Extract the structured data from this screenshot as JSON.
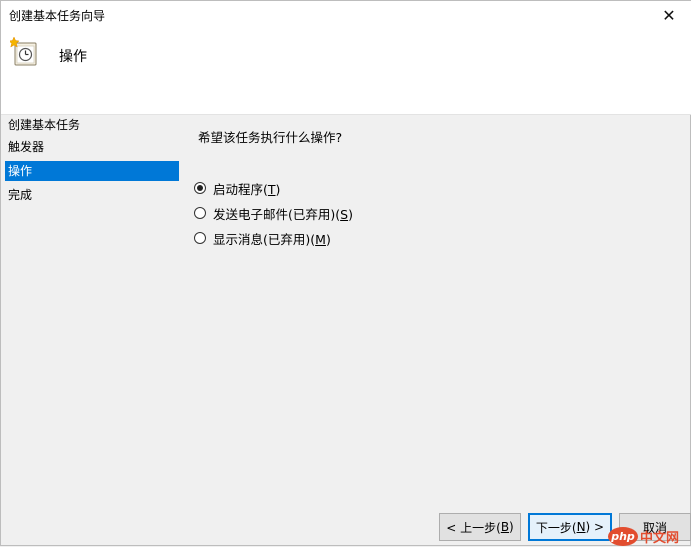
{
  "window": {
    "title": "创建基本任务向导",
    "close_glyph": "✕"
  },
  "header": {
    "title": "操作",
    "icon": "scheduled-task-icon"
  },
  "sidebar": {
    "items": [
      {
        "label": "创建基本任务",
        "active": false
      },
      {
        "label": "触发器",
        "active": false
      },
      {
        "label": "操作",
        "active": true
      },
      {
        "label": "完成",
        "active": false
      }
    ]
  },
  "main": {
    "question": "希望该任务执行什么操作?",
    "options": [
      {
        "label_before": "启动程序(",
        "accel": "T",
        "label_after": ")",
        "checked": true
      },
      {
        "label_before": "发送电子邮件(已弃用)(",
        "accel": "S",
        "label_after": ")",
        "checked": false
      },
      {
        "label_before": "显示消息(已弃用)(",
        "accel": "M",
        "label_after": ")",
        "checked": false
      }
    ]
  },
  "buttons": {
    "back": {
      "before": "< 上一步(",
      "accel": "B",
      "after": ")"
    },
    "next": {
      "before": "下一步(",
      "accel": "N",
      "after": ") >"
    },
    "cancel": {
      "label": "取消"
    }
  },
  "watermark": {
    "badge": "php",
    "text": "中文网"
  },
  "colors": {
    "accent": "#0078d7",
    "background": "#f0f0f0",
    "header_bg": "#ffffff"
  }
}
